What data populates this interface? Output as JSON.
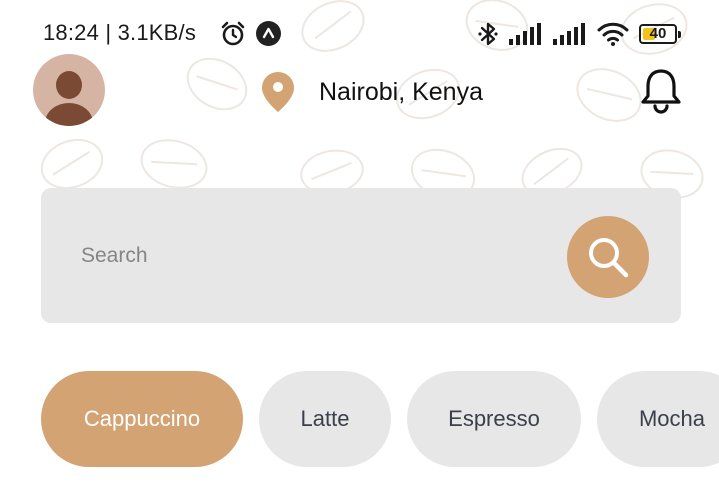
{
  "status_bar": {
    "time": "18:24 | 3.1KB/s",
    "battery_level": "40",
    "icons": [
      "alarm-icon",
      "app-badge-icon",
      "bluetooth-icon",
      "signal-icon",
      "signal-icon",
      "wifi-icon",
      "battery-icon"
    ]
  },
  "header": {
    "location": "Nairobi, Kenya",
    "icons": [
      "avatar",
      "location-pin-icon",
      "bell-icon"
    ]
  },
  "search": {
    "placeholder": "Search",
    "value": ""
  },
  "categories": [
    {
      "label": "Cappuccino",
      "active": true
    },
    {
      "label": "Latte",
      "active": false
    },
    {
      "label": "Espresso",
      "active": false
    },
    {
      "label": "Mocha",
      "active": false
    }
  ],
  "colors": {
    "accent": "#d4a373",
    "chip_background": "#e8e7e7",
    "chip_text": "#3a3f4b",
    "background": "#ffffff"
  }
}
